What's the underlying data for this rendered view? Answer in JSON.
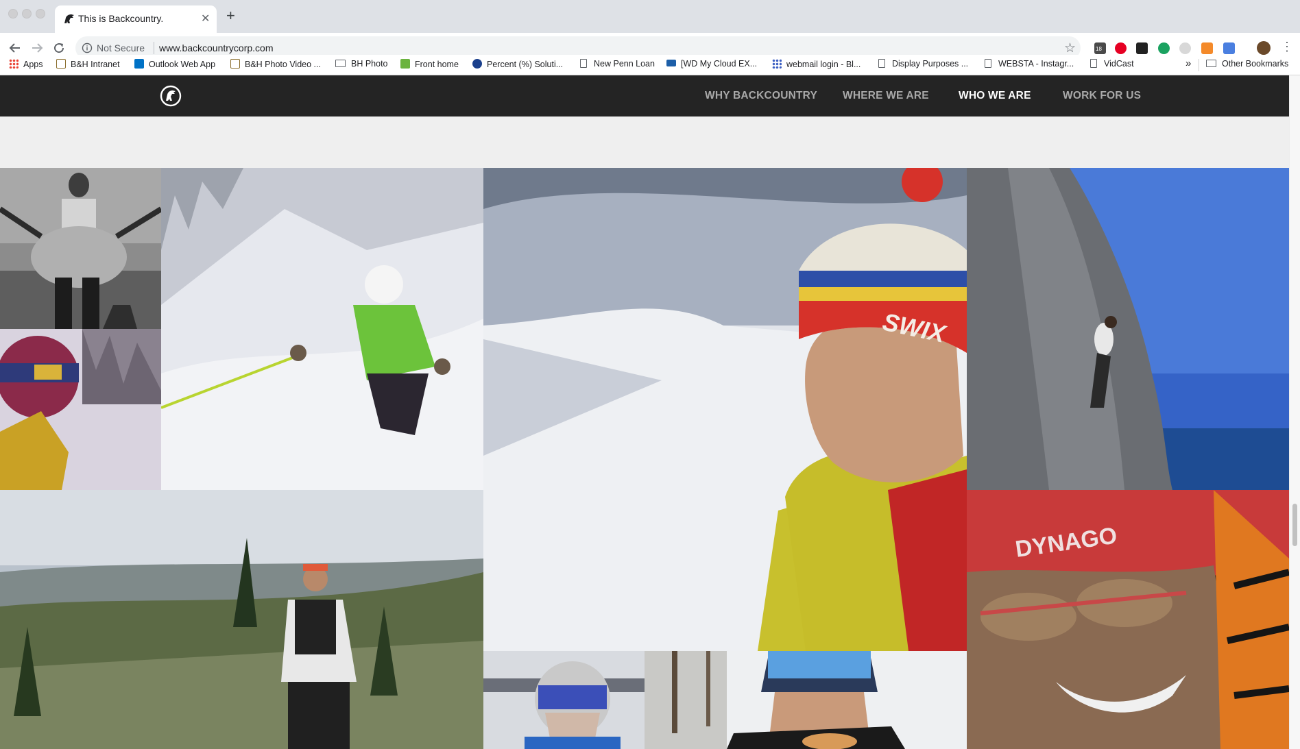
{
  "browser": {
    "tab_title": "This is Backcountry.",
    "security_label": "Not Secure",
    "url": "www.backcountrycorp.com",
    "bookmarks": [
      {
        "label": "Apps",
        "icon": "apps-grid-icon"
      },
      {
        "label": "B&H Intranet",
        "icon": "bh-icon"
      },
      {
        "label": "Outlook Web App",
        "icon": "outlook-icon"
      },
      {
        "label": "B&H Photo Video ...",
        "icon": "bh-icon"
      },
      {
        "label": "BH Photo",
        "icon": "folder-icon"
      },
      {
        "label": "Front home",
        "icon": "green-page-icon"
      },
      {
        "label": "Percent (%) Soluti...",
        "icon": "gear-icon"
      },
      {
        "label": "New Penn Loan",
        "icon": "page-icon"
      },
      {
        "label": "[WD My Cloud EX...",
        "icon": "wd-icon"
      },
      {
        "label": "webmail login - Bl...",
        "icon": "grid-icon"
      },
      {
        "label": "Display Purposes ...",
        "icon": "page-icon"
      },
      {
        "label": "WEBSTA - Instagr...",
        "icon": "page-icon"
      },
      {
        "label": "VidCast",
        "icon": "page-icon"
      }
    ],
    "bookmarks_overflow": "»",
    "other_bookmarks": "Other Bookmarks",
    "calendar_badge": "18"
  },
  "site": {
    "nav": [
      {
        "label": "WHY BACKCOUNTRY",
        "active": false
      },
      {
        "label": "WHERE WE ARE",
        "active": false
      },
      {
        "label": "WHO WE ARE",
        "active": true
      },
      {
        "label": "WORK FOR US",
        "active": false
      }
    ],
    "photo_text": {
      "beanie": "SWIX",
      "cap": "DYNAGO"
    }
  },
  "colors": {
    "nav_background": "#242424",
    "nav_link": "#a9a9a9",
    "nav_link_active": "#ffffff",
    "spacer": "#efefef"
  }
}
